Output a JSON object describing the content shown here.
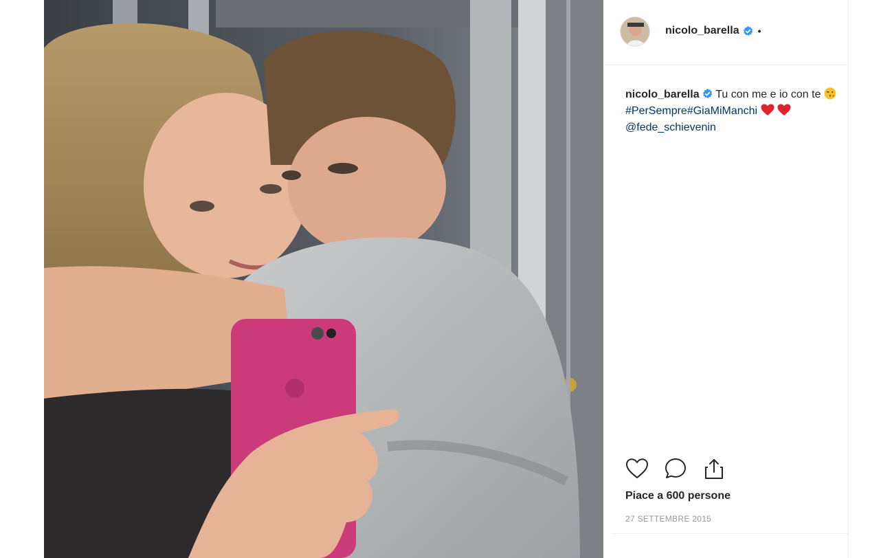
{
  "post": {
    "username": "nicolo_barella",
    "header_separator": "•",
    "caption": {
      "username": "nicolo_barella",
      "text_start": "Tu con me e io con te",
      "hashtags": "#PerSempre#GiaMiManchi",
      "mention": "@fede_schievenin"
    },
    "likes_text": "Piace a 600 persone",
    "date_text": "27 SETTEMBRE 2015"
  },
  "icons": {
    "verified": "verified-badge-icon",
    "like": "heart-outline-icon",
    "comment": "comment-bubble-icon",
    "share": "share-upload-icon"
  },
  "colors": {
    "verified_blue": "#3897f0",
    "link_blue": "#003569",
    "heart_red": "#e0242f",
    "text": "#262626",
    "muted": "#999999"
  }
}
